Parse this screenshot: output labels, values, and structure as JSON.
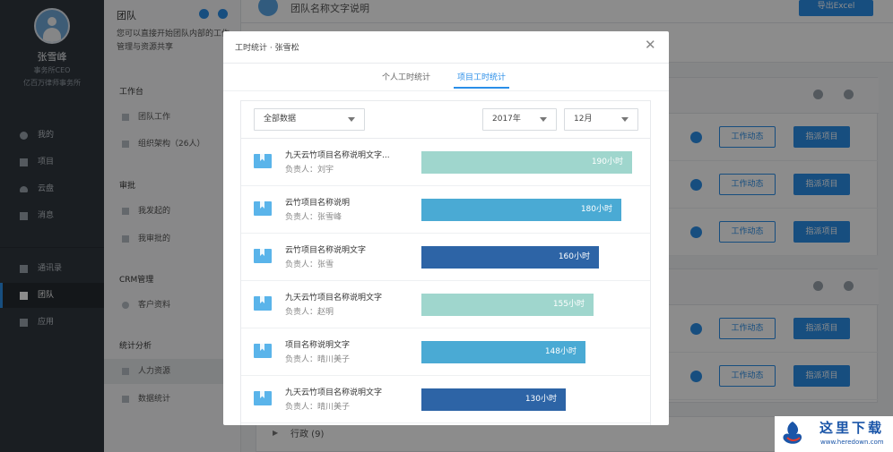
{
  "user": {
    "name": "张雪峰",
    "role": "事务所CEO",
    "org": "亿百万律师事务所"
  },
  "nav": [
    {
      "label": "我的",
      "icon": "person-icon"
    },
    {
      "label": "项目",
      "icon": "project-icon"
    },
    {
      "label": "云盘",
      "icon": "cloud-icon"
    },
    {
      "label": "消息",
      "icon": "message-icon"
    },
    {
      "label": "通讯录",
      "icon": "contacts-icon"
    },
    {
      "label": "团队",
      "icon": "flag-icon",
      "active": true
    },
    {
      "label": "应用",
      "icon": "apps-icon"
    }
  ],
  "team": {
    "title": "团队",
    "desc": "您可以直接开始团队内部的工作管理与资源共享",
    "sections": [
      {
        "heading": "工作台",
        "items": [
          "团队工作",
          "组织架构（26人）"
        ]
      },
      {
        "heading": "审批",
        "items": [
          "我发起的",
          "我审批的"
        ]
      },
      {
        "heading": "CRM管理",
        "items": [
          "客户资料"
        ]
      },
      {
        "heading": "统计分析",
        "items": [
          "人力资源",
          "数据统计"
        ]
      }
    ]
  },
  "main": {
    "title": "团队名称文字说明",
    "export_label": "导出Excel",
    "action_dynamic": "工作动态",
    "action_assign": "指派项目",
    "footer_group": "行政 (9)"
  },
  "modal": {
    "title": "工时统计 · 张雪松",
    "tabs": [
      "个人工时统计",
      "项目工时统计"
    ],
    "active_tab": 1,
    "filters": {
      "scope": "全部数据",
      "year": "2017年",
      "month": "12月"
    },
    "owner_prefix": "负责人：",
    "rows": [
      {
        "name": "九天云竹项目名称说明文字...",
        "owner": "刘宇",
        "hours": 190,
        "label": "190小时",
        "color": "#9fd6cd"
      },
      {
        "name": "云竹项目名称说明",
        "owner": "张雪峰",
        "hours": 180,
        "label": "180小时",
        "color": "#4aaad4"
      },
      {
        "name": "云竹项目名称说明文字",
        "owner": "张雪",
        "hours": 160,
        "label": "160小时",
        "color": "#2d64a6"
      },
      {
        "name": "九天云竹项目名称说明文字",
        "owner": "赵明",
        "hours": 155,
        "label": "155小时",
        "color": "#9fd6cd"
      },
      {
        "name": "项目名称说明文字",
        "owner": "晴川美子",
        "hours": 148,
        "label": "148小时",
        "color": "#4aaad4"
      },
      {
        "name": "九天云竹项目名称说明文字",
        "owner": "晴川美子",
        "hours": 130,
        "label": "130小时",
        "color": "#2d64a6"
      }
    ],
    "max_hours": 190
  },
  "watermark": {
    "text": "这里下载",
    "url": "www.heredown.com"
  }
}
